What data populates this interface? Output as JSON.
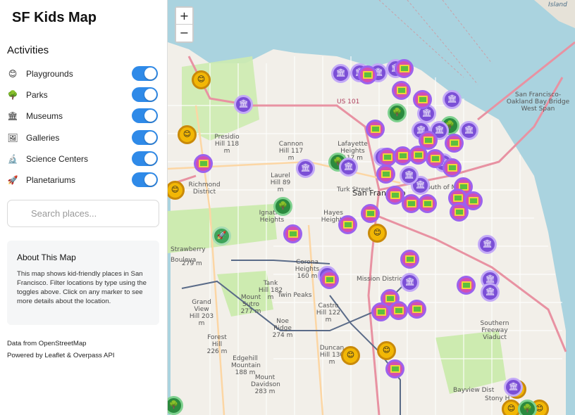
{
  "app": {
    "title": "SF Kids Map"
  },
  "sidebar": {
    "activities_title": "Activities",
    "activities": [
      {
        "label": "Playgrounds",
        "icon": "playground-icon",
        "glyph": "😊",
        "enabled": true
      },
      {
        "label": "Parks",
        "icon": "tree-icon",
        "glyph": "🌳",
        "enabled": true
      },
      {
        "label": "Museums",
        "icon": "museum-icon",
        "glyph": "🏛",
        "enabled": true
      },
      {
        "label": "Galleries",
        "icon": "gallery-icon",
        "glyph": "🖼",
        "enabled": true
      },
      {
        "label": "Science Centers",
        "icon": "microscope-icon",
        "glyph": "🔬",
        "enabled": true
      },
      {
        "label": "Planetariums",
        "icon": "rocket-icon",
        "glyph": "🚀",
        "enabled": true
      }
    ],
    "search": {
      "placeholder": "Search places...",
      "value": ""
    },
    "about": {
      "title": "About This Map",
      "text": "This map shows kid-friendly places in San Francisco. Filter locations by type using the toggles above. Click on any marker to see more details about the location."
    },
    "footer": {
      "data_source": "Data from OpenStreetMap",
      "powered_by": "Powered by Leaflet & Overpass API"
    }
  },
  "map": {
    "zoom_in": "+",
    "zoom_out": "−",
    "colors": {
      "water": "#aad3df",
      "land": "#f2efe9",
      "park": "#cdebb0",
      "museum": "#7b4fd6",
      "gallery": "#d24fb2",
      "toggle_on": "#2f8ae8"
    },
    "labels": {
      "richmond": "Richmond District",
      "sf": "San Francisco",
      "bay_bridge": "San Francisco-Oakland Bay Bridge West Span",
      "mission": "Mission District",
      "presidio": "Presidio Hill 118 m",
      "cannon": "Cannon Hill 117 m",
      "lafayette": "Lafayette Heights 117 m",
      "laurel": "Laurel Hill 89 m",
      "sutro": "Mount Sutro 277 m",
      "twin_peaks": "Twin Peaks",
      "corona": "Corona Heights 160 m",
      "castro": "Castro Hill 122 m",
      "noe": "Noe Ridge 274 m",
      "grand_view": "Grand View Hill 203 m",
      "forest": "Forest Hill 226 m",
      "edgehill": "Edgehill Mountain 188 m",
      "davidson": "Mount Davidson 283 m",
      "duncan": "Duncan Hill 130 m",
      "us101": "US 101",
      "soma": "South of M",
      "southern_fwy": "Southern Freeway Viaduct",
      "bayview": "Bayview Dist",
      "stony": "Stony H",
      "island": "Island",
      "tank": "Tank Hill 182 m",
      "ignatian": "Ignatian Heights",
      "haight": "Hayes Heights",
      "strawberry": "Strawberry",
      "turk": "Turk Street",
      "bvd": "Bouleva",
      "m279": "279 m"
    }
  }
}
